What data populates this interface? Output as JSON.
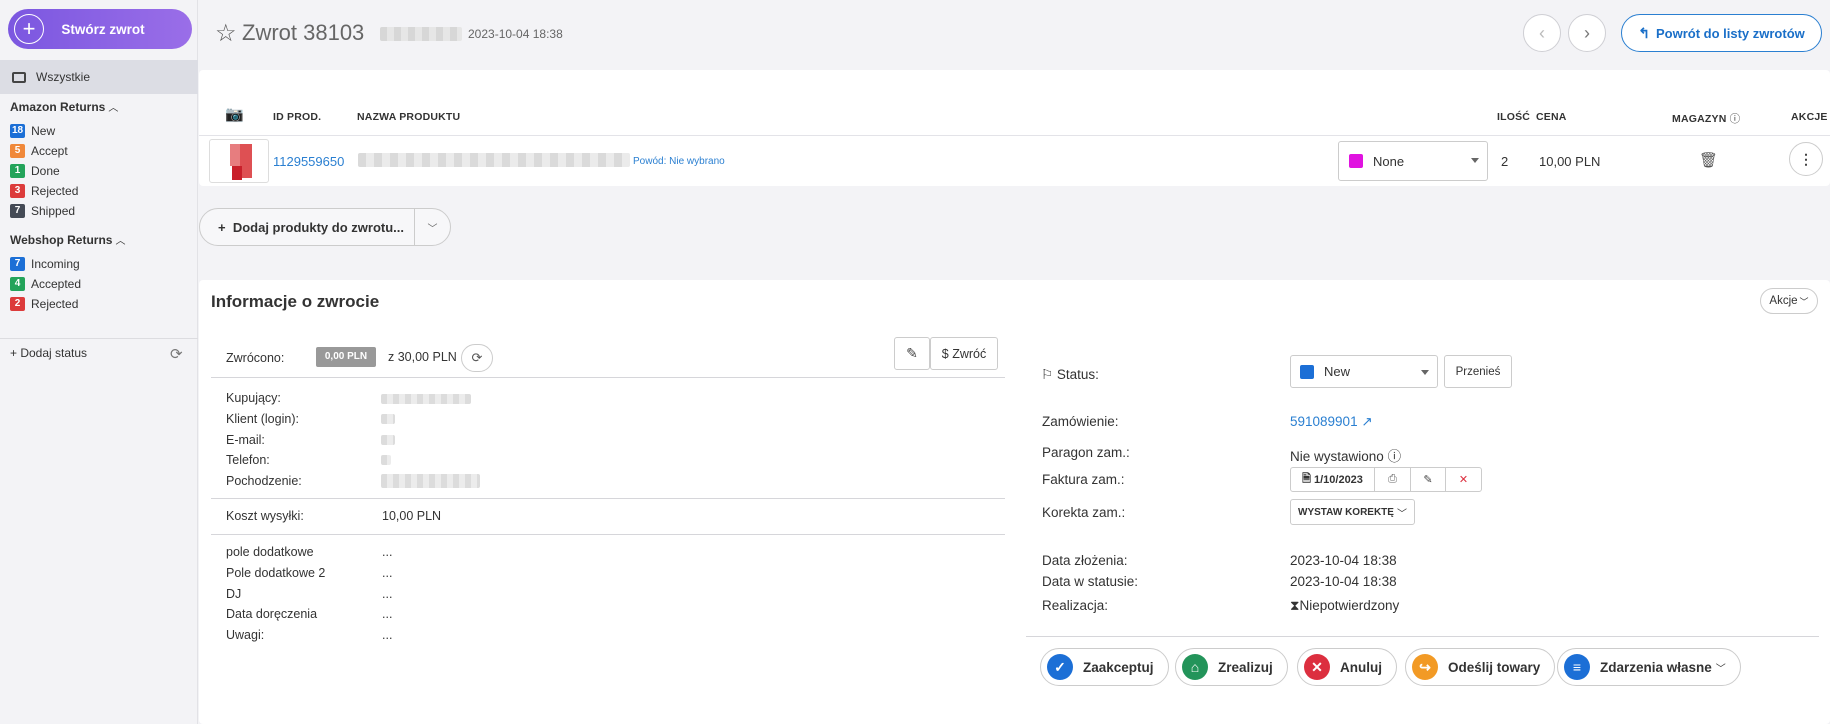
{
  "sidebar": {
    "create_label": "Stwórz zwrot",
    "all_label": "Wszystkie",
    "groups": [
      {
        "title": "Amazon Returns",
        "items": [
          {
            "count": "18",
            "label": "New",
            "color": "#1c6fd6"
          },
          {
            "count": "5",
            "label": "Accept",
            "color": "#f0883a"
          },
          {
            "count": "1",
            "label": "Done",
            "color": "#23a35a"
          },
          {
            "count": "3",
            "label": "Rejected",
            "color": "#dc3b3b"
          },
          {
            "count": "7",
            "label": "Shipped",
            "color": "#444a55"
          }
        ]
      },
      {
        "title": "Webshop Returns",
        "items": [
          {
            "count": "7",
            "label": "Incoming",
            "color": "#1c6fd6"
          },
          {
            "count": "4",
            "label": "Accepted",
            "color": "#23a35a"
          },
          {
            "count": "2",
            "label": "Rejected",
            "color": "#dc3b3b"
          }
        ]
      }
    ],
    "add_status_label": "+ Dodaj status"
  },
  "header": {
    "title": "Zwrot 38103",
    "date": "2023-10-04 18:38",
    "back_label": "Powrót do listy zwrotów"
  },
  "products": {
    "columns": {
      "id": "ID PROD.",
      "name": "NAZWA PRODUKTU",
      "qty": "ILOŚĆ",
      "price": "CENA",
      "warehouse": "MAGAZYN",
      "actions": "AKCJE"
    },
    "rows": [
      {
        "id": "1129559650",
        "reason": "Powód: Nie wybrano",
        "warehouse": "None",
        "warehouse_color": "#e013e0",
        "qty": "2",
        "price": "10,00 PLN"
      }
    ],
    "add_label": "Dodaj produkty do zwrotu..."
  },
  "info": {
    "title": "Informacje o zwrocie",
    "actions_label": "Akcje",
    "refunded_label": "Zwrócono:",
    "refunded_amount": "0,00 PLN",
    "refunded_total": "z 30,00 PLN",
    "refund_btn": "$ Zwróć",
    "customer_fields": [
      "Kupujący:",
      "Klient (login):",
      "E-mail:",
      "Telefon:",
      "Pochodzenie:"
    ],
    "shipping_label": "Koszt wysyłki:",
    "shipping_value": "10,00 PLN",
    "extra_fields": [
      {
        "label": "pole dodatkowe",
        "value": "..."
      },
      {
        "label": "Pole dodatkowe 2",
        "value": "..."
      },
      {
        "label": "DJ",
        "value": "..."
      },
      {
        "label": "Data doręczenia",
        "value": "..."
      },
      {
        "label": "Uwagi:",
        "value": "..."
      }
    ],
    "status_label": "Status:",
    "status_value": "New",
    "status_color": "#1c6fd6",
    "move_label": "Przenieś",
    "order_label": "Zamówienie:",
    "order_value": "591089901",
    "receipt_label": "Paragon zam.:",
    "receipt_value": "Nie wystawiono",
    "invoice_label": "Faktura zam.:",
    "invoice_value": "1/10/2023",
    "correction_label": "Korekta zam.:",
    "correction_btn": "WYSTAW KOREKTĘ",
    "created_label": "Data złożenia:",
    "created_value": "2023-10-04 18:38",
    "status_date_label": "Data w statusie:",
    "status_date_value": "2023-10-04 18:38",
    "realization_label": "Realizacja:",
    "realization_value": "Niepotwierdzony",
    "buttons": [
      {
        "label": "Zaakceptuj",
        "color": "#1c6fd6"
      },
      {
        "label": "Zrealizuj",
        "color": "#23945a"
      },
      {
        "label": "Anuluj",
        "color": "#dc2f3f"
      },
      {
        "label": "Odeślij towary",
        "color": "#f29a25"
      },
      {
        "label": "Zdarzenia własne",
        "color": "#1c6fd6"
      }
    ]
  }
}
